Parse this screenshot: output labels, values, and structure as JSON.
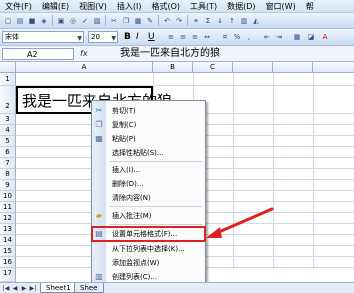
{
  "menubar": {
    "items": [
      "文件(F)",
      "编辑(E)",
      "视图(V)",
      "插入(I)",
      "格式(O)",
      "工具(T)",
      "数据(D)",
      "窗口(W)",
      "帮"
    ]
  },
  "format_toolbar": {
    "font": "宋体",
    "size": "20",
    "bold": "B",
    "italic": "I",
    "underline": "U"
  },
  "formula_bar": {
    "cell_ref": "A2",
    "fx": "fx",
    "content": "我是一匹来自北方的狼"
  },
  "grid": {
    "columns": [
      "A",
      "B",
      "C"
    ],
    "rows": [
      "1",
      "2",
      "3",
      "4",
      "5",
      "6",
      "7",
      "8",
      "9",
      "10",
      "11",
      "12",
      "13",
      "14",
      "15",
      "16",
      "17"
    ],
    "cell_a2": "我是一匹来自北方的狼"
  },
  "context_menu": {
    "items": [
      {
        "label": "剪切(T)",
        "icon": "scissors-icon"
      },
      {
        "label": "复制(C)",
        "icon": "copy-icon"
      },
      {
        "label": "粘贴(P)",
        "icon": "paste-icon"
      },
      {
        "label": "选择性粘贴(S)...",
        "icon": ""
      },
      {
        "label": "插入(I)...",
        "icon": ""
      },
      {
        "label": "删除(D)...",
        "icon": ""
      },
      {
        "label": "清除内容(N)",
        "icon": ""
      },
      {
        "label": "插入批注(M)",
        "icon": "comment-icon"
      },
      {
        "label": "设置单元格格式(F)...",
        "icon": "format-cells-icon"
      },
      {
        "label": "从下拉列表中选择(K)...",
        "icon": ""
      },
      {
        "label": "添加监视点(W)",
        "icon": ""
      },
      {
        "label": "创建列表(C)...",
        "icon": "list-icon"
      }
    ],
    "highlight_color": "#e02020"
  },
  "sheet_tabs": {
    "tabs": [
      "Sheet1",
      "Shee"
    ]
  }
}
